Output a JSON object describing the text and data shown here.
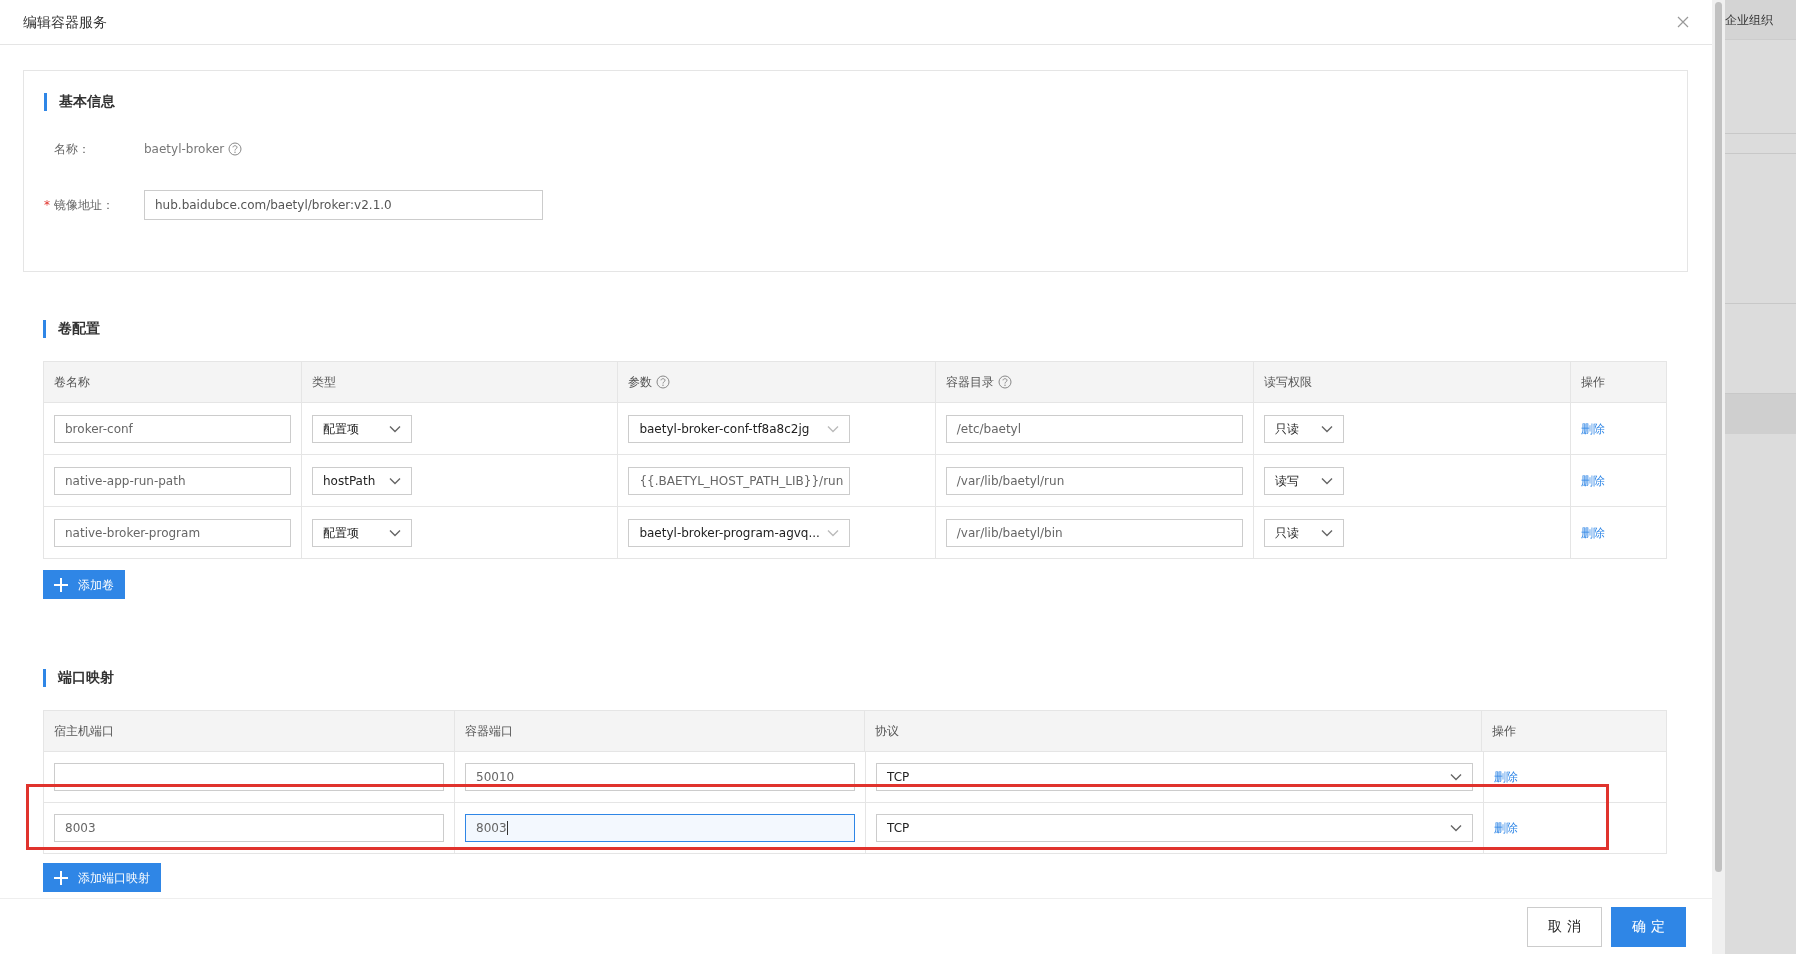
{
  "dialog": {
    "title": "编辑容器服务"
  },
  "basic_info": {
    "heading": "基本信息",
    "fields": [
      {
        "kind": "text",
        "label": "名称：",
        "value": "baetyl-broker",
        "help": true
      },
      {
        "kind": "input",
        "label": "镜像地址：",
        "required_mark": "*",
        "value": "hub.baidubce.com/baetyl/broker:v2.1.0",
        "help": false
      }
    ]
  },
  "volumes": {
    "heading": "卷配置",
    "columns": [
      {
        "label": "卷名称",
        "help": false
      },
      {
        "label": "类型",
        "help": false
      },
      {
        "label": "参数",
        "help": true
      },
      {
        "label": "容器目录",
        "help": true
      },
      {
        "label": "读写权限",
        "help": false
      },
      {
        "label": "操作",
        "help": false
      }
    ],
    "rows": [
      {
        "name": "broker-conf",
        "type": "配置项",
        "param": {
          "kind": "select",
          "value": "baetyl-broker-conf-tf8a8c2jg"
        },
        "dir": "/etc/baetyl",
        "access": "只读",
        "action": "删除"
      },
      {
        "name": "native-app-run-path",
        "type": "hostPath",
        "param": {
          "kind": "input",
          "value": "{{.BAETYL_HOST_PATH_LIB}}/run"
        },
        "dir": "/var/lib/baetyl/run",
        "access": "读写",
        "action": "删除"
      },
      {
        "name": "native-broker-program",
        "type": "配置项",
        "param": {
          "kind": "select",
          "value": "baetyl-broker-program-agvq..."
        },
        "dir": "/var/lib/baetyl/bin",
        "access": "只读",
        "action": "删除"
      }
    ],
    "add_button": "添加卷"
  },
  "ports": {
    "heading": "端口映射",
    "columns": [
      {
        "label": "宿主机端口"
      },
      {
        "label": "容器端口"
      },
      {
        "label": "协议"
      },
      {
        "label": "操作"
      }
    ],
    "rows": [
      {
        "container_port": {
          "value": "50010",
          "focused": false
        },
        "protocol": "TCP",
        "action": "删除",
        "highlighted": false
      },
      {
        "host_port": "8003",
        "container_port": {
          "value": "8003",
          "focused": true
        },
        "protocol": "TCP",
        "action": "删除",
        "highlighted": true
      }
    ],
    "add_button": "添加端口映射"
  },
  "footer": {
    "buttons": [
      {
        "kind": "secondary",
        "label": "取 消"
      },
      {
        "kind": "primary",
        "label": "确 定"
      }
    ]
  },
  "background": {
    "text": "企业组织"
  }
}
